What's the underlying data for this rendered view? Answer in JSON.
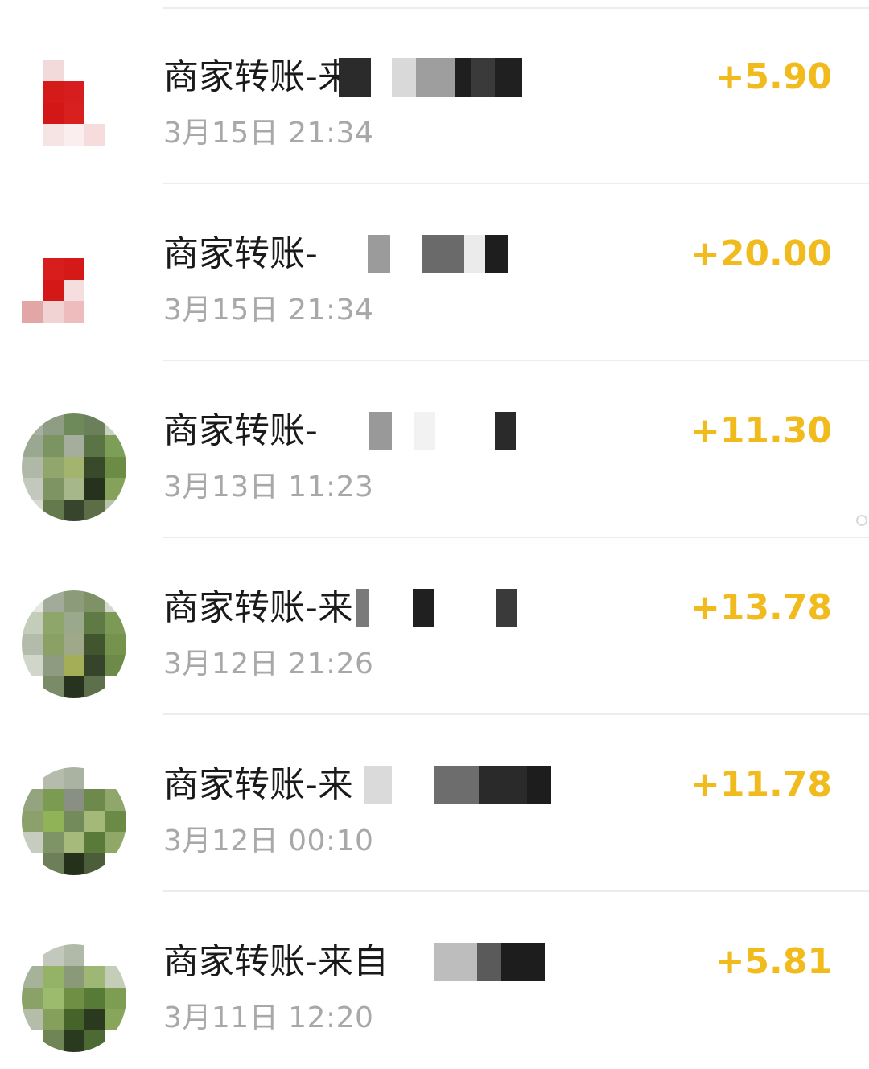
{
  "transactions": [
    {
      "title": "商家转账-来",
      "date": "3月15日 21:34",
      "amount": "+5.90",
      "avatar": "red-logo"
    },
    {
      "title": "商家转账-",
      "date": "3月15日 21:34",
      "amount": "+20.00",
      "avatar": "red-logo"
    },
    {
      "title": "商家转账-",
      "date": "3月13日 11:23",
      "amount": "+11.30",
      "avatar": "plant-photo"
    },
    {
      "title": "商家转账-来",
      "date": "3月12日 21:26",
      "amount": "+13.78",
      "avatar": "plant-photo"
    },
    {
      "title": "商家转账-来",
      "date": "3月12日 00:10",
      "amount": "+11.78",
      "avatar": "plant-photo"
    },
    {
      "title": "商家转账-来自",
      "date": "3月11日 12:20",
      "amount": "+5.81",
      "avatar": "plant-photo"
    }
  ],
  "colors": {
    "amount": "#f2bb1d",
    "title": "#1a1a1a",
    "date": "#a8a8a8",
    "divider": "#ececec"
  }
}
